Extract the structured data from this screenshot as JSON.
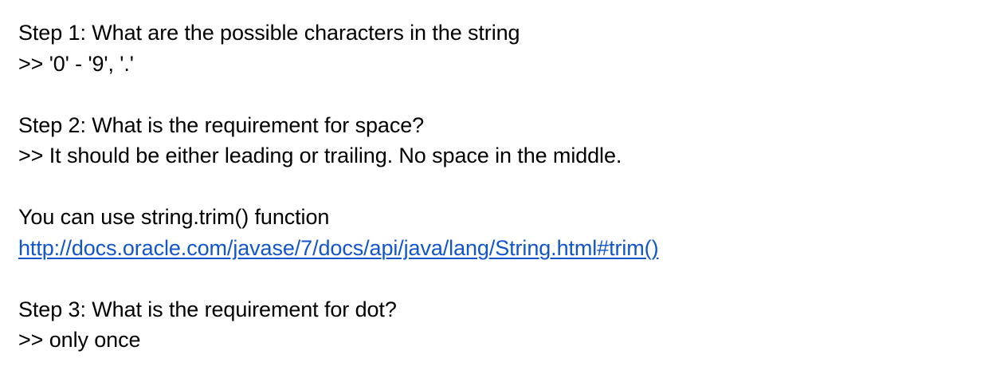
{
  "step1": {
    "question": "Step 1: What are the possible characters in the string",
    "answer": ">> '0' - '9', '.'"
  },
  "step2": {
    "question": "Step 2: What is the requirement for space?",
    "answer": ">> It should be either leading or trailing. No space in the middle."
  },
  "tip": {
    "text": "You can use string.trim() function",
    "link": "http://docs.oracle.com/javase/7/docs/api/java/lang/String.html#trim()"
  },
  "step3": {
    "question": "Step 3: What is the requirement for dot?",
    "answer": ">> only once"
  },
  "colors": {
    "text": "#000000",
    "link": "#1155cc",
    "background": "#ffffff"
  }
}
